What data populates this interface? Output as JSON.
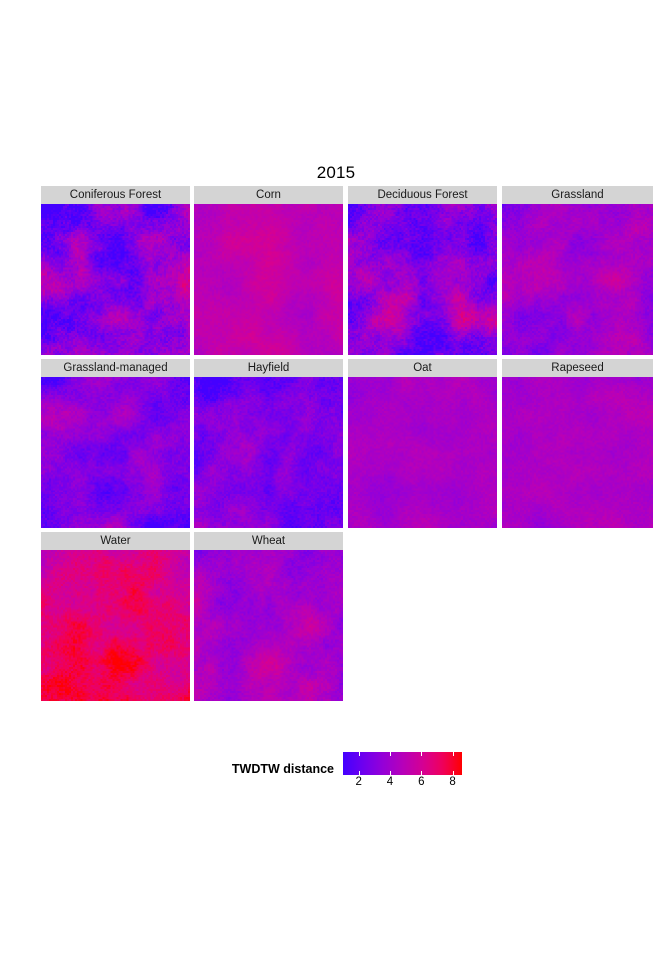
{
  "figure": {
    "title": "2015",
    "background_color": "#ffffff"
  },
  "panels": [
    {
      "label": "Coniferous Forest",
      "row": 0,
      "col": 0,
      "mean_distance": 3.4,
      "texture": "mixed-blue-magenta",
      "seed": 11
    },
    {
      "label": "Corn",
      "row": 0,
      "col": 1,
      "mean_distance": 5.1,
      "texture": "uniform-magenta",
      "seed": 22
    },
    {
      "label": "Deciduous Forest",
      "row": 0,
      "col": 2,
      "mean_distance": 3.8,
      "texture": "mixed-blue-magenta",
      "seed": 33
    },
    {
      "label": "Grassland",
      "row": 0,
      "col": 3,
      "mean_distance": 4.0,
      "texture": "mixed-violet",
      "seed": 44
    },
    {
      "label": "Grassland-managed",
      "row": 1,
      "col": 0,
      "mean_distance": 3.1,
      "texture": "mostly-blue",
      "seed": 55
    },
    {
      "label": "Hayfield",
      "row": 1,
      "col": 1,
      "mean_distance": 3.3,
      "texture": "mostly-blue",
      "seed": 66
    },
    {
      "label": "Oat",
      "row": 1,
      "col": 2,
      "mean_distance": 4.3,
      "texture": "uniform-violet",
      "seed": 77
    },
    {
      "label": "Rapeseed",
      "row": 1,
      "col": 3,
      "mean_distance": 4.4,
      "texture": "uniform-violet",
      "seed": 88
    },
    {
      "label": "Water",
      "row": 2,
      "col": 0,
      "mean_distance": 6.6,
      "texture": "mostly-red",
      "seed": 99
    },
    {
      "label": "Wheat",
      "row": 2,
      "col": 1,
      "mean_distance": 4.2,
      "texture": "mixed-violet",
      "seed": 110
    }
  ],
  "legend": {
    "title": "TWDTW distance",
    "ticks": [
      2,
      4,
      6,
      8
    ],
    "range": [
      1.0,
      8.6
    ],
    "color_low": "#4400ff",
    "color_mid": "#b800bb",
    "color_high": "#ff0000"
  },
  "chart_data": {
    "type": "heatmap",
    "title": "2015",
    "xlabel": "",
    "ylabel": "",
    "colorbar_label": "TWDTW distance",
    "colorbar_ticks": [
      2,
      4,
      6,
      8
    ],
    "colorbar_range": [
      1.0,
      8.6
    ],
    "colormap": [
      "#4400ff",
      "#b800bb",
      "#ff0000"
    ],
    "facets": [
      "Coniferous Forest",
      "Corn",
      "Deciduous Forest",
      "Grassland",
      "Grassland-managed",
      "Hayfield",
      "Oat",
      "Rapeseed",
      "Water",
      "Wheat"
    ],
    "facet_mean_values": [
      3.4,
      5.1,
      3.8,
      4.0,
      3.1,
      3.3,
      4.3,
      4.4,
      6.6,
      4.2
    ],
    "grid": false,
    "legend_position": "bottom"
  }
}
